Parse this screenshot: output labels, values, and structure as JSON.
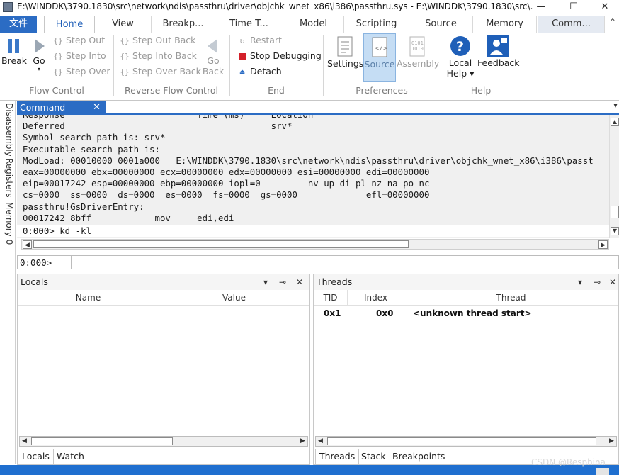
{
  "window": {
    "title": "E:\\WINDDK\\3790.1830\\src\\network\\ndis\\passthru\\driver\\objchk_wnet_x86\\i386\\passthru.sys - E:\\WINDDK\\3790.1830\\src\\...",
    "controls": {
      "minimize": "—",
      "maximize": "☐",
      "close": "✕"
    }
  },
  "menu": {
    "file": "文件",
    "tabs": [
      "Home",
      "View",
      "Breakp...",
      "Time T...",
      "Model",
      "Scripting",
      "Source",
      "Memory",
      "Comm..."
    ],
    "collapse": "⌃"
  },
  "ribbon": {
    "flow_control": {
      "label": "Flow Control",
      "break": "Break",
      "go": "Go",
      "step_out": "Step Out",
      "step_into": "Step Into",
      "step_over": "Step Over"
    },
    "reverse_flow": {
      "label": "Reverse Flow Control",
      "step_out_back": "Step Out Back",
      "step_into_back": "Step Into Back",
      "step_over_back": "Step Over Back",
      "go_back_1": "Go",
      "go_back_2": "Back"
    },
    "end": {
      "label": "End",
      "restart": "Restart",
      "stop": "Stop Debugging",
      "detach": "Detach"
    },
    "preferences": {
      "label": "Preferences",
      "settings": "Settings",
      "source": "Source",
      "assembly": "Assembly"
    },
    "help": {
      "label": "Help",
      "local_help_1": "Local",
      "local_help_2": "Help ▾",
      "feedback": "Feedback"
    }
  },
  "left_tabs": [
    "Disassembly",
    "Registers",
    "Memory 0"
  ],
  "command": {
    "tab_label": "Command",
    "lines": [
      "Response                         Time (ms)     Location",
      "Deferred                                       srv*",
      "Symbol search path is: srv*",
      "Executable search path is:",
      "ModLoad: 00010000 0001a000   E:\\WINDDK\\3790.1830\\src\\network\\ndis\\passthru\\driver\\objchk_wnet_x86\\i386\\passt",
      "eax=00000000 ebx=00000000 ecx=00000000 edx=00000000 esi=00000000 edi=00000000",
      "eip=00017242 esp=00000000 ebp=00000000 iopl=0         nv up di pl nz na po nc",
      "cs=0000  ss=0000  ds=0000  es=0000  fs=0000  gs=0000             efl=00000000",
      "passthru!GsDriverEntry:",
      "00017242 8bff            mov     edi,edi"
    ],
    "typed_line": "0:000> kd -kl",
    "prompt": "0:000>"
  },
  "locals": {
    "title": "Locals",
    "columns": [
      "Name",
      "Value"
    ]
  },
  "threads": {
    "title": "Threads",
    "columns": [
      "TID",
      "Index",
      "Thread"
    ],
    "rows": [
      {
        "tid": "0x1",
        "index": "0x0",
        "thread": "<unknown thread start>"
      }
    ]
  },
  "bottom_tabs_left": [
    "Locals",
    "Watch"
  ],
  "bottom_tabs_right": [
    "Threads",
    "Stack",
    "Breakpoints"
  ],
  "watermark": "CSDN @Resphina",
  "colors": {
    "accent": "#2b6cc4",
    "status": "#1f6fcf"
  }
}
